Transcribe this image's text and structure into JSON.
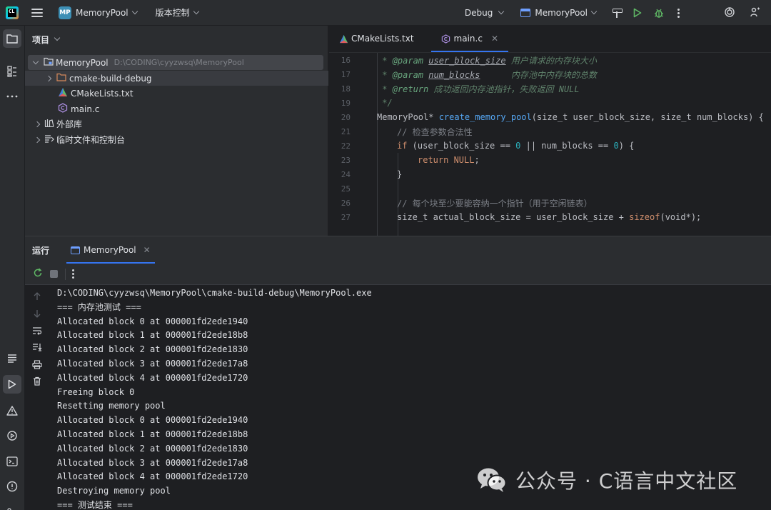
{
  "titlebar": {
    "project_badge": "MP",
    "project_name": "MemoryPool",
    "vcs_label": "版本控制",
    "build_config": "Debug",
    "run_config": "MemoryPool"
  },
  "project_panel": {
    "title": "项目",
    "root": {
      "name": "MemoryPool",
      "path": "D:\\CODING\\cyyzwsq\\MemoryPool"
    },
    "items": [
      {
        "name": "cmake-build-debug",
        "type": "folder"
      },
      {
        "name": "CMakeLists.txt",
        "type": "cmake"
      },
      {
        "name": "main.c",
        "type": "c-file"
      }
    ],
    "external_libs": "外部库",
    "scratches": "临时文件和控制台"
  },
  "editor": {
    "tabs": [
      {
        "label": "CMakeLists.txt",
        "active": false
      },
      {
        "label": "main.c",
        "active": true
      }
    ],
    "line_numbers": [
      "16",
      "17",
      "18",
      "19",
      "20",
      "21",
      "22",
      "23",
      "24",
      "25",
      "26",
      "27"
    ],
    "lines": {
      "l16": {
        "star": " * ",
        "tag": "@param",
        "param": "user_block_size",
        "text": " 用户请求的内存块大小"
      },
      "l17": {
        "star": " * ",
        "tag": "@param",
        "param": "num_blocks",
        "text": "      内存池中内存块的总数"
      },
      "l18": {
        "star": " * ",
        "tag": "@return",
        "text": " 成功返回内存池指针，失败返回 NULL"
      },
      "l19": " */",
      "l20": {
        "a": "MemoryPool* ",
        "fn": "create_memory_pool",
        "b": "(size_t user_block_size, size_t num_blocks) {"
      },
      "l21": "// 检查参数合法性",
      "l22": {
        "kw": "if",
        "a": " (user_block_size == ",
        "n1": "0",
        "b": " || num_blocks == ",
        "n2": "0",
        "c": ") {"
      },
      "l23": {
        "kw": "return",
        "val": " NULL",
        "end": ";"
      },
      "l24": "}",
      "l26": "// 每个块至少要能容纳一个指针（用于空闲链表）",
      "l27": {
        "a": "size_t actual_block_size = user_block_size + ",
        "kw": "sizeof",
        "b": "(void*);"
      }
    }
  },
  "run_panel": {
    "title": "运行",
    "tab_label": "MemoryPool",
    "output": [
      "D:\\CODING\\cyyzwsq\\MemoryPool\\cmake-build-debug\\MemoryPool.exe",
      "=== 内存池测试 ===",
      "Allocated block 0 at 000001fd2ede1940",
      "Allocated block 1 at 000001fd2ede18b8",
      "Allocated block 2 at 000001fd2ede1830",
      "Allocated block 3 at 000001fd2ede17a8",
      "Allocated block 4 at 000001fd2ede1720",
      "Freeing block 0",
      "Resetting memory pool",
      "Allocated block 0 at 000001fd2ede1940",
      "Allocated block 1 at 000001fd2ede18b8",
      "Allocated block 2 at 000001fd2ede1830",
      "Allocated block 3 at 000001fd2ede17a8",
      "Allocated block 4 at 000001fd2ede1720",
      "Destroying memory pool",
      "=== 测试结束 ==="
    ]
  },
  "watermark": {
    "text": "公众号 · C语言中文社区"
  },
  "colors": {
    "accent": "#3574f0",
    "run_green": "#5fb865",
    "keyword": "#cf8e6d",
    "function": "#56a8f5",
    "number": "#2aacb8"
  }
}
